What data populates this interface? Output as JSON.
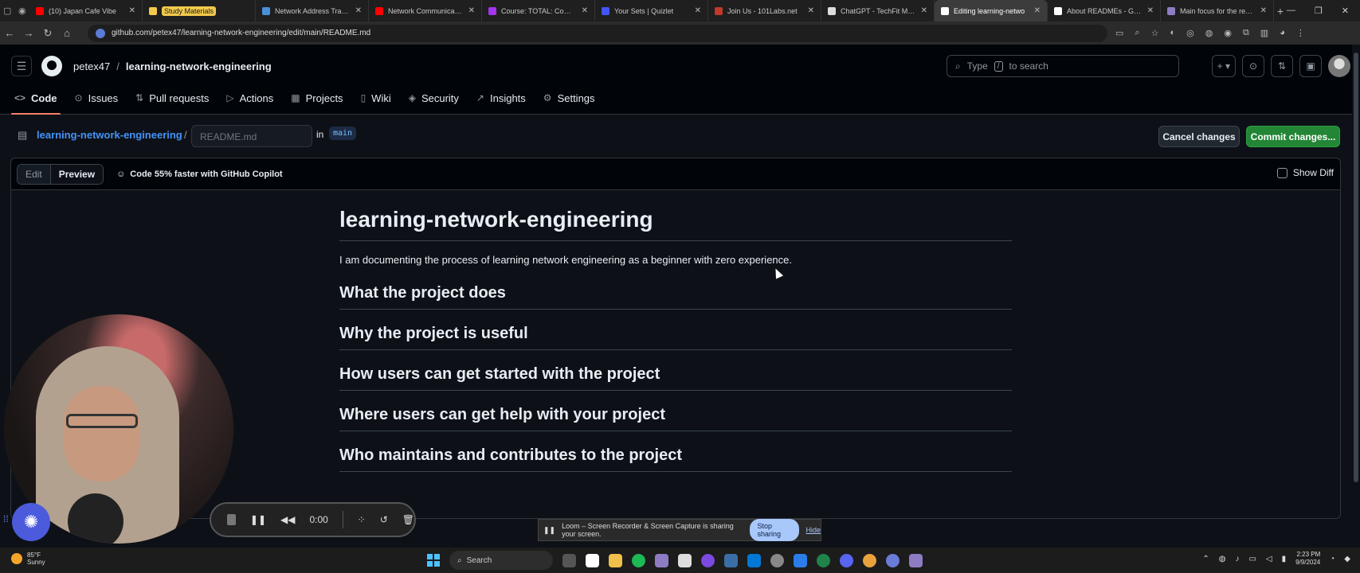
{
  "browser": {
    "tabs": [
      {
        "label": "(10) Japan Cafe Vibe",
        "color": "#ff0000",
        "active": false,
        "highlight": false
      },
      {
        "label": "Study Materials",
        "color": "#f2c94c",
        "active": false,
        "highlight": true
      },
      {
        "label": "Network Address Translat",
        "color": "#4a90d9",
        "active": false,
        "highlight": false
      },
      {
        "label": "Network Communication",
        "color": "#ff0000",
        "active": false,
        "highlight": false
      },
      {
        "label": "Course: TOTAL: CompTIA N",
        "color": "#a435f0",
        "active": false,
        "highlight": false
      },
      {
        "label": "Your Sets | Quizlet",
        "color": "#4255ff",
        "active": false,
        "highlight": false
      },
      {
        "label": "Join Us - 101Labs.net",
        "color": "#c0392b",
        "active": false,
        "highlight": false
      },
      {
        "label": "ChatGPT - TechFit Mentor",
        "color": "#dddddd",
        "active": false,
        "highlight": false
      },
      {
        "label": "Editing learning-netwo",
        "color": "#ffffff",
        "active": true,
        "highlight": false
      },
      {
        "label": "About READMEs - GitHub",
        "color": "#ffffff",
        "active": false,
        "highlight": false
      },
      {
        "label": "Main focus for the rest of",
        "color": "#8e7cc3",
        "active": false,
        "highlight": false
      }
    ],
    "url": "github.com/petex47/learning-network-engineering/edit/main/README.md"
  },
  "header": {
    "owner": "petex47",
    "separator": "/",
    "repo": "learning-network-engineering",
    "search_prefix": "Type",
    "search_key": "/",
    "search_suffix": "to search"
  },
  "nav": {
    "items": [
      {
        "label": "Code",
        "icon": "code-icon",
        "glyph": "<>",
        "active": true
      },
      {
        "label": "Issues",
        "icon": "issue-icon",
        "glyph": "⊙",
        "active": false
      },
      {
        "label": "Pull requests",
        "icon": "pull-request-icon",
        "glyph": "⇅",
        "active": false
      },
      {
        "label": "Actions",
        "icon": "play-icon",
        "glyph": "▷",
        "active": false
      },
      {
        "label": "Projects",
        "icon": "table-icon",
        "glyph": "▦",
        "active": false
      },
      {
        "label": "Wiki",
        "icon": "book-icon",
        "glyph": "▯",
        "active": false
      },
      {
        "label": "Security",
        "icon": "shield-icon",
        "glyph": "◈",
        "active": false
      },
      {
        "label": "Insights",
        "icon": "graph-icon",
        "glyph": "↗",
        "active": false
      },
      {
        "label": "Settings",
        "icon": "gear-icon",
        "glyph": "⚙",
        "active": false
      }
    ]
  },
  "editor": {
    "repo_link": "learning-network-engineering",
    "slash": "/",
    "filename_placeholder": "README.md",
    "in_label": "in",
    "branch": "main",
    "cancel_label": "Cancel changes",
    "commit_label": "Commit changes...",
    "edit_tab": "Edit",
    "preview_tab": "Preview",
    "copilot_text": "Code 55% faster with GitHub Copilot",
    "show_diff": "Show Diff"
  },
  "readme": {
    "title": "learning-network-engineering",
    "intro": "I am documenting the process of learning network engineering as a beginner with zero experience.",
    "sections": [
      "What the project does",
      "Why the project is useful",
      "How users can get started with the project",
      "Where users can get help with your project",
      "Who maintains and contributes to the project"
    ]
  },
  "recorder": {
    "time": "0:00"
  },
  "share_banner": {
    "text": "Loom – Screen Recorder & Screen Capture is sharing your screen.",
    "stop_label": "Stop sharing",
    "hide_label": "Hide"
  },
  "taskbar": {
    "temp": "85°F",
    "condition": "Sunny",
    "search_label": "Search",
    "time": "2:23 PM",
    "date": "9/9/2024"
  }
}
